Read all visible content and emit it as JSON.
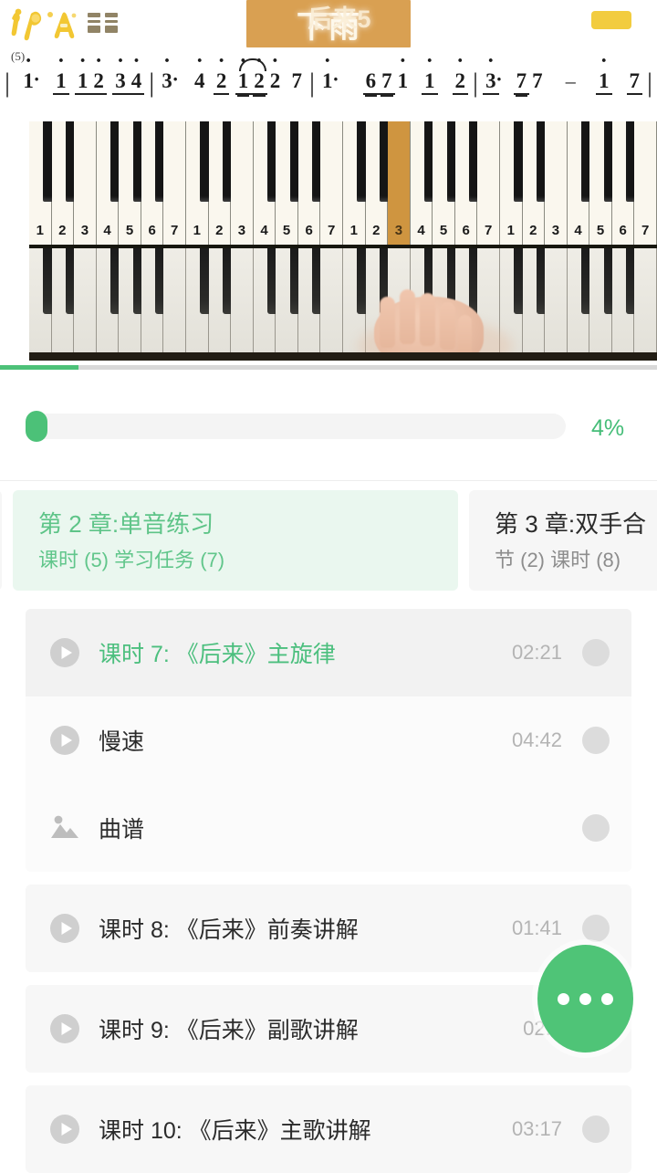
{
  "header": {
    "brand_logo": "piano-course-logo",
    "title_main": "下雨",
    "title_ghost": "后来5",
    "chip": "yellow-chip",
    "bar_number": "(5)"
  },
  "notation": {
    "measures": [
      {
        "notes": [
          "1·"
        ]
      },
      {
        "notes": [
          "1",
          "1",
          "2",
          "3",
          "4"
        ]
      },
      {
        "notes": [
          "3·"
        ]
      },
      {
        "notes": [
          "4",
          "2",
          "1",
          "2",
          "2",
          "7"
        ]
      },
      {
        "notes": [
          "1·"
        ]
      },
      {
        "notes": [
          "6",
          "7",
          "1"
        ]
      },
      {
        "notes": [
          "1",
          "2"
        ]
      },
      {
        "notes": [
          "3·",
          "7",
          "7"
        ]
      },
      {
        "notes": [
          "-"
        ]
      },
      {
        "notes": [
          "1",
          "7"
        ]
      }
    ]
  },
  "piano": {
    "degrees": [
      "1",
      "2",
      "3",
      "4",
      "5",
      "6",
      "7"
    ],
    "octaves": 4,
    "highlighted_degree": "3",
    "highlighted_octave": 3,
    "video_progress_percent": 12
  },
  "progress": {
    "percent_label": "4%",
    "percent_value": 4
  },
  "chapters": [
    {
      "title": "第 2 章:单音练习",
      "subtitle": "课时 (5) 学习任务 (7)",
      "active": true
    },
    {
      "title": "第 3 章:双手合",
      "subtitle": "节 (2) 课时 (8)",
      "active": false
    }
  ],
  "lessons": [
    {
      "rows": [
        {
          "icon": "play-icon",
          "label": "课时 7: 《后来》主旋律",
          "time": "02:21",
          "selected": true
        },
        {
          "icon": "play-icon",
          "label": "慢速",
          "time": "04:42",
          "selected": false
        },
        {
          "icon": "image-icon",
          "label": "曲谱",
          "time": "",
          "selected": false
        }
      ]
    },
    {
      "rows": [
        {
          "icon": "play-icon",
          "label": "课时 8: 《后来》前奏讲解",
          "time": "01:41",
          "selected": false
        }
      ]
    },
    {
      "rows": [
        {
          "icon": "play-icon",
          "label": "课时 9: 《后来》副歌讲解",
          "time": "02:3",
          "selected": false
        }
      ]
    },
    {
      "rows": [
        {
          "icon": "play-icon",
          "label": "课时 10: 《后来》主歌讲解",
          "time": "03:17",
          "selected": false
        }
      ]
    }
  ],
  "fab": {
    "name": "more-actions-button",
    "icon": "ellipsis-icon"
  },
  "colors": {
    "accent_green": "#4cc178",
    "accent_green_text": "#45bd78",
    "banner_amber": "#d9a052",
    "chip_yellow": "#f2cc3f",
    "highlight_key": "#cf9540",
    "active_chapter_bg": "#eaf7ef",
    "row_bg": "#f7f7f7"
  }
}
